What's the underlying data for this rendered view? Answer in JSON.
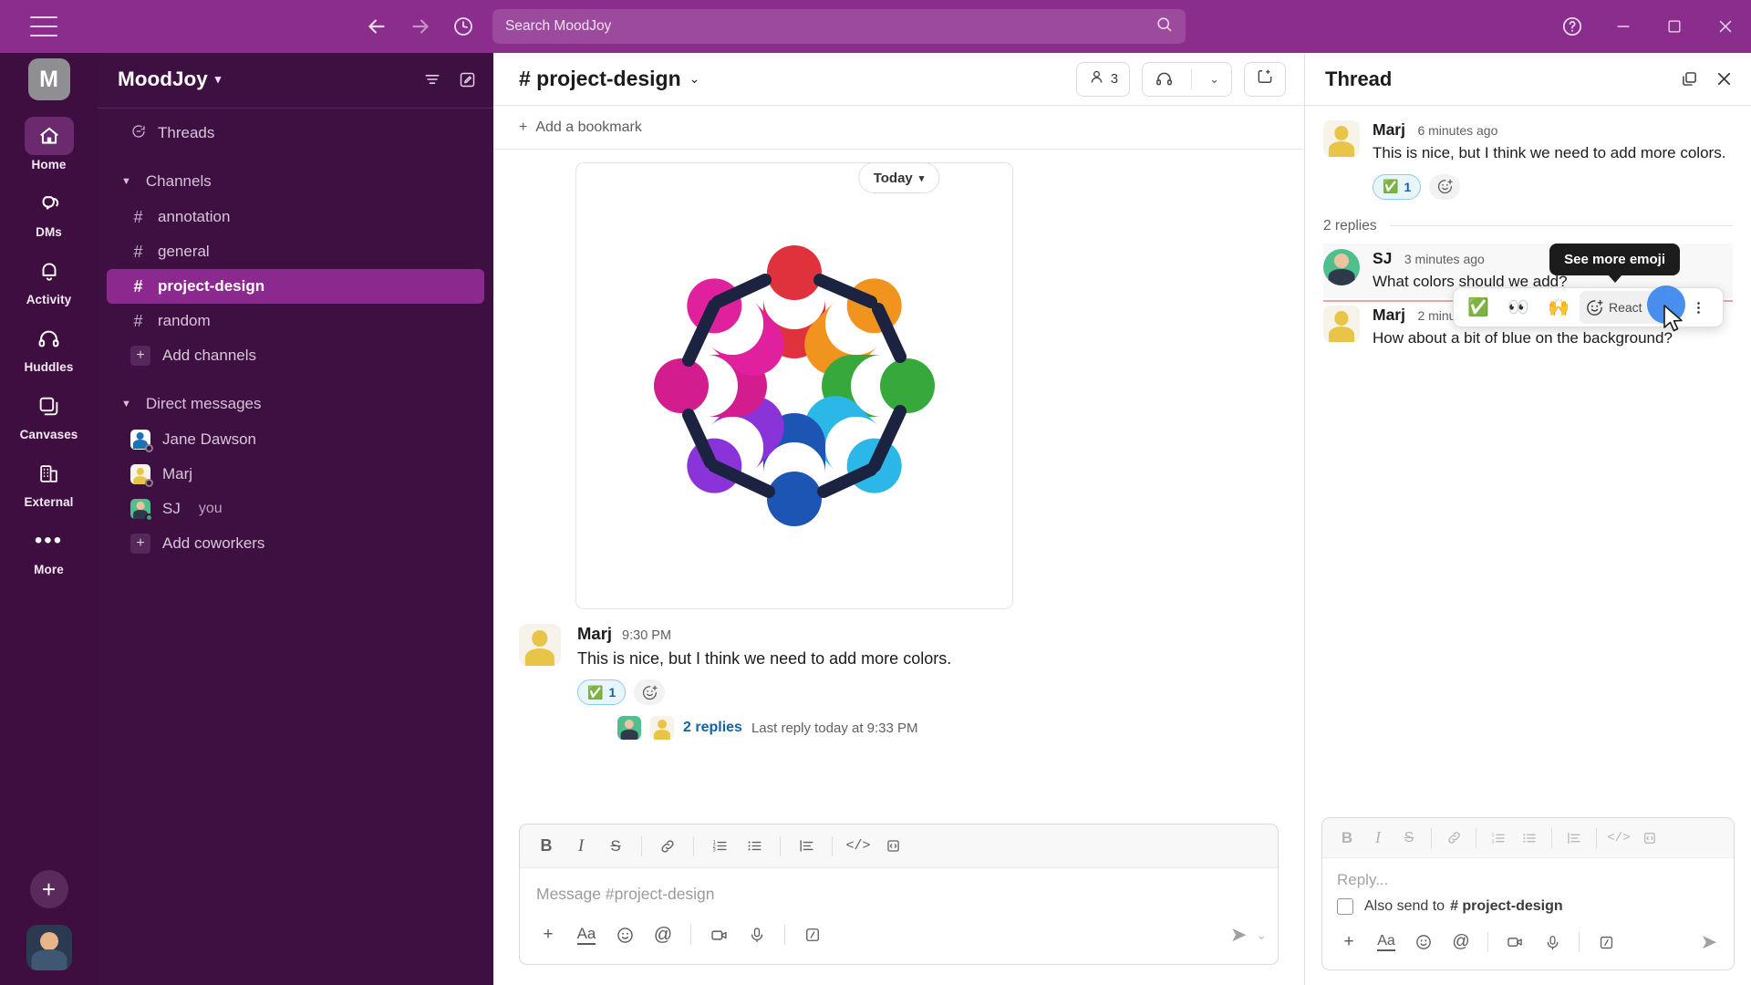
{
  "window": {
    "search_placeholder": "Search MoodJoy",
    "help_icon": "help-circle-icon",
    "minimize_icon": "minimize-icon",
    "maximize_icon": "maximize-icon",
    "close_icon": "close-icon",
    "back_icon": "back-arrow-icon",
    "forward_icon": "forward-arrow-icon",
    "history_icon": "clock-history-icon",
    "menu_icon": "hamburger-menu-icon"
  },
  "rail": {
    "workspace_initial": "M",
    "items": [
      {
        "label": "Home",
        "icon": "home-icon",
        "active": true
      },
      {
        "label": "DMs",
        "icon": "dms-icon",
        "active": false
      },
      {
        "label": "Activity",
        "icon": "bell-icon",
        "active": false
      },
      {
        "label": "Huddles",
        "icon": "headphones-icon",
        "active": false
      },
      {
        "label": "Canvases",
        "icon": "canvas-icon",
        "active": false
      },
      {
        "label": "External",
        "icon": "building-icon",
        "active": false
      },
      {
        "label": "More",
        "icon": "ellipsis-icon",
        "active": false
      }
    ],
    "new_label": "+"
  },
  "sidebar": {
    "workspace_name": "MoodJoy",
    "filter_icon": "filter-icon",
    "compose_icon": "compose-icon",
    "threads_label": "Threads",
    "channels_section": "Channels",
    "channels": [
      {
        "name": "annotation",
        "selected": false
      },
      {
        "name": "general",
        "selected": false
      },
      {
        "name": "project-design",
        "selected": true
      },
      {
        "name": "random",
        "selected": false
      }
    ],
    "add_channels": "Add channels",
    "dm_section": "Direct messages",
    "dms": [
      {
        "name": "Jane Dawson",
        "avatar": "blue",
        "presence": "away",
        "you": ""
      },
      {
        "name": "Marj",
        "avatar": "yellow",
        "presence": "away",
        "you": ""
      },
      {
        "name": "SJ",
        "avatar": "green",
        "presence": "online",
        "you": "you"
      }
    ],
    "add_coworkers": "Add coworkers"
  },
  "main": {
    "channel_name": "# project-design",
    "members_count": "3",
    "huddle_icon": "headphones-icon",
    "huddle_caret": "chevron-down-icon",
    "canvas_icon": "new-canvas-icon",
    "bookmark_label": "Add a bookmark",
    "today_label": "Today",
    "message": {
      "author": "Marj",
      "time": "9:30 PM",
      "text": "This is nice, but I think we need to add more colors.",
      "reaction_emoji": "✅",
      "reaction_count": "1",
      "add_reaction_icon": "add-reaction-icon",
      "replies_link": "2 replies",
      "replies_meta": "Last reply today at 9:33 PM"
    },
    "composer": {
      "placeholder": "Message #project-design",
      "toolbar": [
        "bold",
        "italic",
        "strikethrough",
        "link",
        "ordered-list",
        "bulleted-list",
        "blockquote",
        "code",
        "code-block"
      ],
      "actions": [
        "plus",
        "formatting",
        "emoji",
        "mention",
        "video",
        "audio",
        "slash-command"
      ],
      "send_icon": "send-icon",
      "send_caret": "chevron-down-icon"
    }
  },
  "thread": {
    "title": "Thread",
    "expand_icon": "open-in-window-icon",
    "close_icon": "close-icon",
    "root": {
      "author": "Marj",
      "time": "6 minutes ago",
      "text": "This is nice, but I think we need to add more colors.",
      "reaction_emoji": "✅",
      "reaction_count": "1",
      "add_reaction_icon": "add-reaction-icon"
    },
    "replies_label": "2 replies",
    "replies": [
      {
        "author": "SJ",
        "time": "3 minutes ago",
        "text": "What colors should we add?",
        "avatar": "green",
        "hovered": true
      },
      {
        "author": "Marj",
        "time": "2 minutes ago",
        "text": "How about a bit of blue on the background?",
        "avatar": "yellow",
        "hovered": false
      }
    ],
    "hover_toolbar": {
      "quick_emojis": [
        "✅",
        "👀",
        "🙌"
      ],
      "react_label": "React",
      "react_icon": "add-reaction-icon",
      "more_icon": "more-actions-icon"
    },
    "tooltip": "See more emoji",
    "composer": {
      "placeholder": "Reply...",
      "also_send_label": "Also send to",
      "also_send_channel": "# project-design",
      "checked": false,
      "send_icon": "send-icon"
    }
  },
  "colors": {
    "brand_purple": "#3F0E40",
    "topbar_purple": "#8A2D8C",
    "selected_channel": "#8B298F",
    "link_blue": "#1264A3",
    "cursor_blue": "#2F80ED"
  }
}
